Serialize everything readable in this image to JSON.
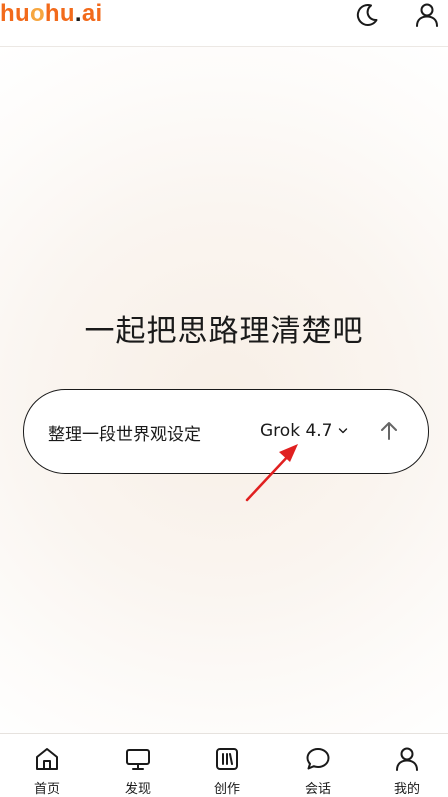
{
  "header": {
    "logo_chars": [
      "h",
      "u",
      "o",
      "h",
      "u",
      ".",
      "a",
      "i"
    ],
    "logo_colors": [
      "#f26a1b",
      "#f26a1b",
      "#f6a640",
      "#f26a1b",
      "#f26a1b",
      "#1a1a1a",
      "#f26a1b",
      "#f26a1b"
    ],
    "icons": [
      "moon-icon",
      "user-icon"
    ]
  },
  "hero": {
    "title": "一起把思路理清楚吧"
  },
  "prompt": {
    "text": "整理一段世界观设定",
    "model": "Grok 4.7",
    "model_icon": "chevron-down-icon",
    "send_icon": "arrow-up-icon"
  },
  "nav": {
    "items": [
      {
        "label": "首页",
        "icon": "home-icon"
      },
      {
        "label": "发现",
        "icon": "monitor-icon"
      },
      {
        "label": "创作",
        "icon": "create-icon"
      },
      {
        "label": "会话",
        "icon": "chat-icon"
      },
      {
        "label": "我的",
        "icon": "user-icon"
      }
    ]
  },
  "colors": {
    "brand": "#f26a1b",
    "annotation": "#e02020",
    "text": "#1a1a1a"
  }
}
